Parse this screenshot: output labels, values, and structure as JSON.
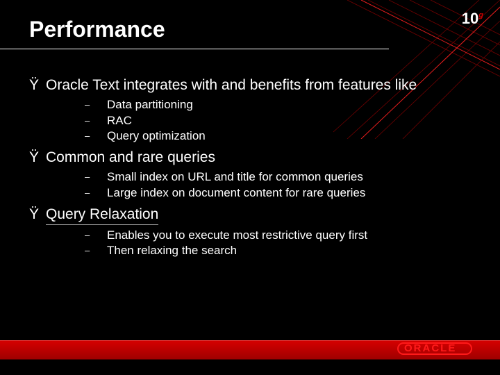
{
  "header": {
    "title": "Performance",
    "product_badge": "10",
    "product_badge_sup": "g"
  },
  "bullets": [
    {
      "marker": "Ÿ",
      "text": "Oracle Text integrates with and benefits from features like",
      "sub": [
        {
          "marker": "–",
          "text": "Data partitioning"
        },
        {
          "marker": "–",
          "text": "RAC"
        },
        {
          "marker": "–",
          "text": "Query optimization"
        }
      ]
    },
    {
      "marker": "Ÿ",
      "text": "Common and rare queries",
      "sub": [
        {
          "marker": "–",
          "text": "Small index on URL and title for common queries"
        },
        {
          "marker": "–",
          "text": "Large index on document content for rare queries"
        }
      ]
    },
    {
      "marker": "Ÿ",
      "text": "Query Relaxation",
      "underline": true,
      "sub": [
        {
          "marker": "–",
          "text": "Enables you to execute most restrictive query first"
        },
        {
          "marker": "–",
          "text": "Then relaxing the search"
        }
      ]
    }
  ],
  "footer": {
    "brand": "ORACLE"
  }
}
